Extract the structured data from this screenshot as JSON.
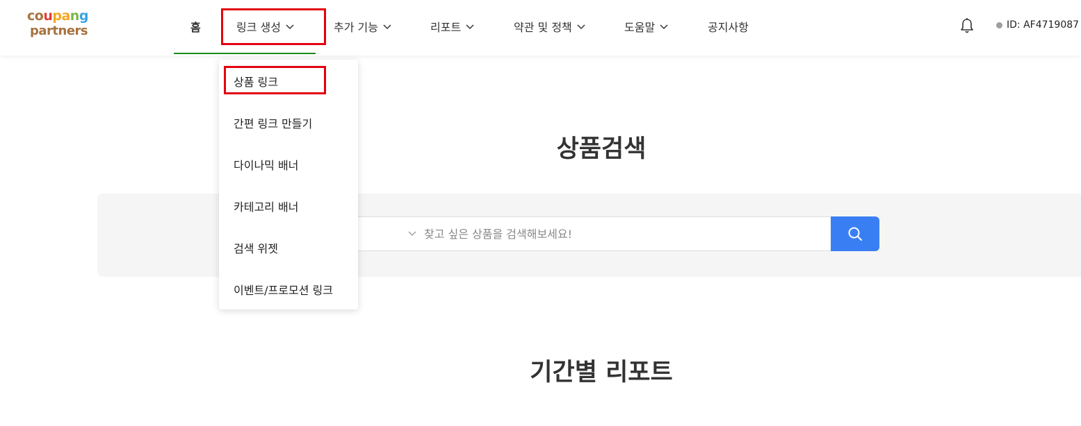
{
  "logo": {
    "line1": [
      "c",
      "o",
      "u",
      "p",
      "a",
      "n",
      "g"
    ],
    "line2": "partners"
  },
  "nav": {
    "home": "홈",
    "link_create": "링크 생성",
    "extra": "추가 기능",
    "report": "리포트",
    "terms": "약관 및 정책",
    "help": "도움말",
    "notice": "공지사항"
  },
  "user": {
    "id_label": "ID: AF4719087",
    "status_color": "#9e9e9e"
  },
  "dropdown": {
    "items": [
      "상품 링크",
      "간편 링크 만들기",
      "다이나믹 배너",
      "카테고리 배너",
      "검색 위젯",
      "이벤트/프로모션 링크"
    ]
  },
  "main": {
    "search_title": "상품검색",
    "search_placeholder": "찾고 싶은 상품을 검색해보세요!",
    "report_title": "기간별 리포트"
  },
  "colors": {
    "accent": "#3a7ef3",
    "highlight": "#e3000f",
    "active_underline": "#1a8a1a"
  },
  "icons": {
    "bell": "bell-icon",
    "search": "search-icon",
    "chevron": "chevron-down-icon"
  }
}
